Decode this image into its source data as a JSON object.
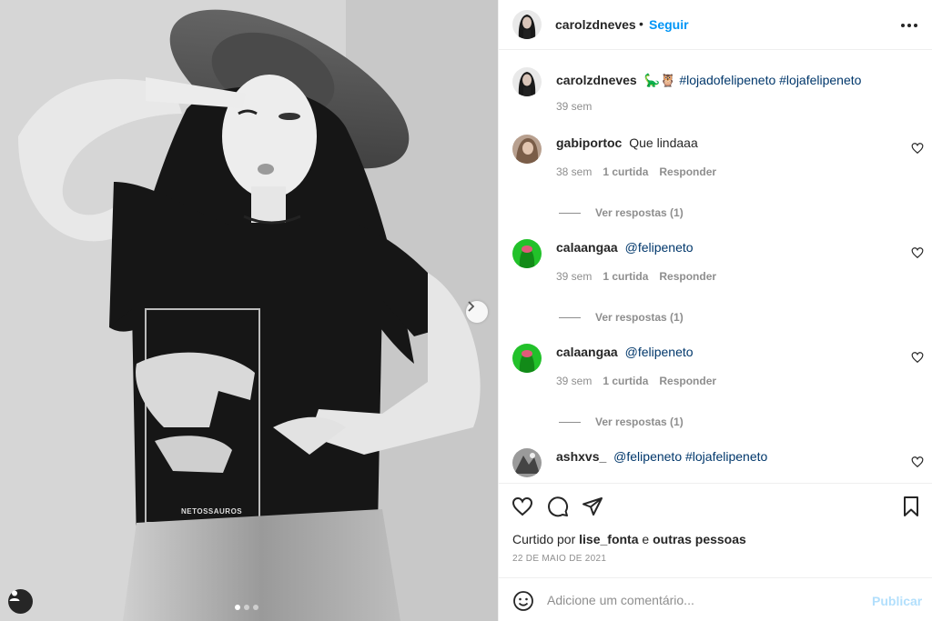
{
  "post": {
    "author": "carolzdneves",
    "separator": "•",
    "follow_label": "Seguir",
    "caption": {
      "user": "carolzdneves",
      "emoji": "🦕🦉",
      "hashtags": "#lojadofelipeneto #lojafelipeneto",
      "time": "39 sem"
    }
  },
  "photo": {
    "shirt_text": "NETOSSAUROS",
    "carousel_count": 3,
    "carousel_active": 0
  },
  "comments": [
    {
      "user": "gabiportoc",
      "text": "Que lindaaa",
      "time": "38 sem",
      "likes": "1 curtida",
      "reply": "Responder",
      "view_replies": "Ver respostas (1)"
    },
    {
      "user": "calaangaa",
      "text": "@felipeneto",
      "time": "39 sem",
      "likes": "1 curtida",
      "reply": "Responder",
      "view_replies": "Ver respostas (1)"
    },
    {
      "user": "calaangaa",
      "text": "@felipeneto",
      "time": "39 sem",
      "likes": "1 curtida",
      "reply": "Responder",
      "view_replies": "Ver respostas (1)"
    },
    {
      "user": "ashxvs_",
      "text": "@felipeneto #lojafelipeneto"
    }
  ],
  "likes": {
    "prefix": "Curtido por",
    "user": "lise_fonta",
    "conj": "e",
    "others": "outras pessoas"
  },
  "date": "22 DE MAIO DE 2021",
  "add_comment": {
    "placeholder": "Adicione um comentário...",
    "publish_label": "Publicar"
  },
  "icons": {
    "heart": "heart-icon",
    "comment": "comment-icon",
    "share": "paper-plane-icon",
    "save": "bookmark-icon",
    "more": "more-horizontal-icon",
    "emoji": "smiley-icon",
    "next": "chevron-right-icon",
    "tags": "user-tag-icon"
  },
  "colors": {
    "accent": "#0095f6",
    "link": "#00376b",
    "muted": "#8e8e8e",
    "publish_disabled": "#b2dffc",
    "commenter_green": "#22c12a"
  }
}
